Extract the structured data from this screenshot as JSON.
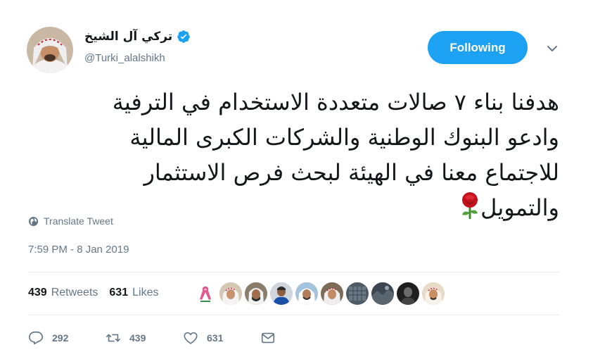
{
  "user": {
    "display_name": "تركي آل الشيخ",
    "handle": "@Turki_alalshikh",
    "verified_icon": "verified-badge-icon",
    "avatar_icon": "user-avatar"
  },
  "header": {
    "follow_label": "Following",
    "menu_icon": "chevron-down-icon"
  },
  "tweet": {
    "text_lines": [
      "هدفنا بناء ٧ صالات متعددة الاستخدام في الترفية",
      "وادعو البنوك الوطنية والشركات الكبرى المالية",
      "للاجتماع معنا في الهيئة لبحث فرص الاستثمار",
      "والتمويل"
    ],
    "emoji_icon": "rose-icon",
    "translate_label": "Translate Tweet",
    "timestamp": "7:59 PM - 8 Jan 2019"
  },
  "stats": {
    "retweets_count": "439",
    "retweets_label": "Retweets",
    "likes_count": "631",
    "likes_label": "Likes"
  },
  "likers": [
    {
      "name": "liker-avatar-1",
      "icon": "pink-ribbon-logo"
    },
    {
      "name": "liker-avatar-2",
      "icon": "user-avatar"
    },
    {
      "name": "liker-avatar-3",
      "icon": "user-avatar"
    },
    {
      "name": "liker-avatar-4",
      "icon": "user-avatar"
    },
    {
      "name": "liker-avatar-5",
      "icon": "user-avatar"
    },
    {
      "name": "liker-avatar-6",
      "icon": "user-avatar"
    },
    {
      "name": "liker-avatar-7",
      "icon": "user-avatar"
    },
    {
      "name": "liker-avatar-8",
      "icon": "user-avatar"
    },
    {
      "name": "liker-avatar-9",
      "icon": "user-avatar"
    },
    {
      "name": "liker-avatar-10",
      "icon": "user-avatar"
    }
  ],
  "actions": {
    "reply_count": "292",
    "retweet_count": "439",
    "like_count": "631",
    "reply_icon": "reply-icon",
    "retweet_icon": "retweet-icon",
    "like_icon": "heart-icon",
    "dm_icon": "envelope-icon"
  },
  "colors": {
    "accent": "#1da1f2",
    "text": "#14171a",
    "secondary": "#657786",
    "divider": "#e6ecf0"
  }
}
